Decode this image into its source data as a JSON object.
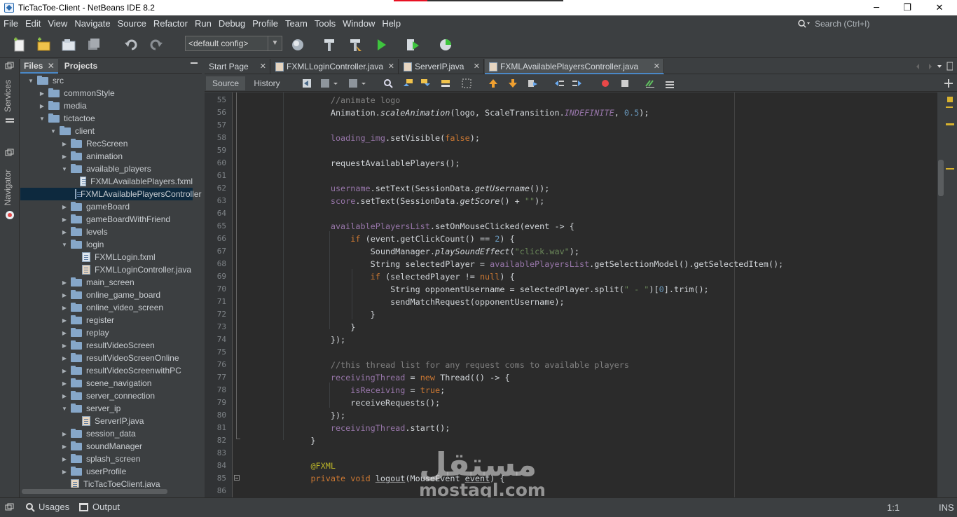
{
  "window": {
    "title": "TicTacToe-Client - NetBeans IDE 8.2",
    "minimize": "─",
    "maximize": "❐",
    "close": "✕"
  },
  "menu": {
    "items": [
      "File",
      "Edit",
      "View",
      "Navigate",
      "Source",
      "Refactor",
      "Run",
      "Debug",
      "Profile",
      "Team",
      "Tools",
      "Window",
      "Help"
    ],
    "search_placeholder": "Search (Ctrl+I)"
  },
  "toolbar": {
    "config_value": "<default config>"
  },
  "panel": {
    "tabs": [
      {
        "label": "Files",
        "close": "✕"
      },
      {
        "label": "Projects"
      }
    ],
    "tree": [
      {
        "indent": 0,
        "expand": "▼",
        "type": "folder",
        "label": "src"
      },
      {
        "indent": 1,
        "expand": "▶",
        "type": "folder",
        "label": "commonStyle"
      },
      {
        "indent": 1,
        "expand": "▶",
        "type": "folder",
        "label": "media"
      },
      {
        "indent": 1,
        "expand": "▼",
        "type": "folder",
        "label": "tictactoe"
      },
      {
        "indent": 2,
        "expand": "▼",
        "type": "folder",
        "label": "client"
      },
      {
        "indent": 3,
        "expand": "▶",
        "type": "folder",
        "label": "RecScreen"
      },
      {
        "indent": 3,
        "expand": "▶",
        "type": "folder",
        "label": "animation"
      },
      {
        "indent": 3,
        "expand": "▼",
        "type": "folder",
        "label": "available_players"
      },
      {
        "indent": 4,
        "expand": "",
        "type": "fxml",
        "label": "FXMLAvailablePlayers.fxml"
      },
      {
        "indent": 4,
        "expand": "",
        "type": "java",
        "label": "FXMLAvailablePlayersController",
        "selected": true
      },
      {
        "indent": 3,
        "expand": "▶",
        "type": "folder",
        "label": "gameBoard"
      },
      {
        "indent": 3,
        "expand": "▶",
        "type": "folder",
        "label": "gameBoardWithFriend"
      },
      {
        "indent": 3,
        "expand": "▶",
        "type": "folder",
        "label": "levels"
      },
      {
        "indent": 3,
        "expand": "▼",
        "type": "folder",
        "label": "login"
      },
      {
        "indent": 4,
        "expand": "",
        "type": "fxml",
        "label": "FXMLLogin.fxml"
      },
      {
        "indent": 4,
        "expand": "",
        "type": "java",
        "label": "FXMLLoginController.java"
      },
      {
        "indent": 3,
        "expand": "▶",
        "type": "folder",
        "label": "main_screen"
      },
      {
        "indent": 3,
        "expand": "▶",
        "type": "folder",
        "label": "online_game_board"
      },
      {
        "indent": 3,
        "expand": "▶",
        "type": "folder",
        "label": "online_video_screen"
      },
      {
        "indent": 3,
        "expand": "▶",
        "type": "folder",
        "label": "register"
      },
      {
        "indent": 3,
        "expand": "▶",
        "type": "folder",
        "label": "replay"
      },
      {
        "indent": 3,
        "expand": "▶",
        "type": "folder",
        "label": "resultVideoScreen"
      },
      {
        "indent": 3,
        "expand": "▶",
        "type": "folder",
        "label": "resultVideoScreenOnline"
      },
      {
        "indent": 3,
        "expand": "▶",
        "type": "folder",
        "label": "resultVideoScreenwithPC"
      },
      {
        "indent": 3,
        "expand": "▶",
        "type": "folder",
        "label": "scene_navigation"
      },
      {
        "indent": 3,
        "expand": "▶",
        "type": "folder",
        "label": "server_connection"
      },
      {
        "indent": 3,
        "expand": "▼",
        "type": "folder",
        "label": "server_ip"
      },
      {
        "indent": 4,
        "expand": "",
        "type": "java",
        "label": "ServerIP.java"
      },
      {
        "indent": 3,
        "expand": "▶",
        "type": "folder",
        "label": "session_data"
      },
      {
        "indent": 3,
        "expand": "▶",
        "type": "folder",
        "label": "soundManager"
      },
      {
        "indent": 3,
        "expand": "▶",
        "type": "folder",
        "label": "splash_screen"
      },
      {
        "indent": 3,
        "expand": "▶",
        "type": "folder",
        "label": "userProfile"
      },
      {
        "indent": 3,
        "expand": "",
        "type": "java",
        "label": "TicTacToeClient.java"
      }
    ]
  },
  "side_labels": {
    "services": "Services",
    "navigator": "Navigator"
  },
  "editor_tabs": [
    {
      "label": "Start Page",
      "close": "✕"
    },
    {
      "label": "FXMLLoginController.java",
      "close": "✕"
    },
    {
      "label": "ServerIP.java",
      "close": "✕"
    },
    {
      "label": "FXMLAvailablePlayersController.java",
      "close": "✕",
      "active": true
    }
  ],
  "editor_toolbar": {
    "source": "Source",
    "history": "History"
  },
  "code": [
    {
      "n": "55",
      "tokens": [
        [
          "                  ",
          ""
        ],
        [
          "//animate logo",
          "c-com"
        ]
      ]
    },
    {
      "n": "56",
      "tokens": [
        [
          "                  Animation.",
          ""
        ],
        [
          "scaleAnimation",
          "c-it"
        ],
        [
          "(logo, ScaleTransition.",
          ""
        ],
        [
          "INDEFINITE",
          "c-fld c-it"
        ],
        [
          ", ",
          ""
        ],
        [
          "0.5",
          "c-num"
        ],
        [
          ");",
          ""
        ]
      ]
    },
    {
      "n": "57",
      "tokens": [
        [
          "",
          ""
        ]
      ]
    },
    {
      "n": "58",
      "tokens": [
        [
          "                  ",
          ""
        ],
        [
          "loading_img",
          "c-fld"
        ],
        [
          ".setVisible(",
          ""
        ],
        [
          "false",
          "c-kw"
        ],
        [
          ");",
          ""
        ]
      ]
    },
    {
      "n": "59",
      "tokens": [
        [
          "",
          ""
        ]
      ]
    },
    {
      "n": "60",
      "tokens": [
        [
          "                  requestAvailablePlayers();",
          ""
        ]
      ]
    },
    {
      "n": "61",
      "tokens": [
        [
          "",
          ""
        ]
      ]
    },
    {
      "n": "62",
      "tokens": [
        [
          "                  ",
          ""
        ],
        [
          "username",
          "c-fld"
        ],
        [
          ".setText(SessionData.",
          ""
        ],
        [
          "getUsername",
          "c-it"
        ],
        [
          "());",
          ""
        ]
      ]
    },
    {
      "n": "63",
      "tokens": [
        [
          "                  ",
          ""
        ],
        [
          "score",
          "c-fld"
        ],
        [
          ".setText(SessionData.",
          ""
        ],
        [
          "getScore",
          "c-it"
        ],
        [
          "() + ",
          ""
        ],
        [
          "\"\"",
          "c-str"
        ],
        [
          ");",
          ""
        ]
      ]
    },
    {
      "n": "64",
      "tokens": [
        [
          "",
          ""
        ]
      ]
    },
    {
      "n": "65",
      "tokens": [
        [
          "                  ",
          ""
        ],
        [
          "availablePlayersList",
          "c-fld"
        ],
        [
          ".setOnMouseClicked(event -> {",
          ""
        ]
      ]
    },
    {
      "n": "66",
      "tokens": [
        [
          "                      ",
          ""
        ],
        [
          "if",
          "c-kw"
        ],
        [
          " (event.getClickCount() == ",
          ""
        ],
        [
          "2",
          "c-num"
        ],
        [
          ") {",
          ""
        ]
      ]
    },
    {
      "n": "67",
      "tokens": [
        [
          "                          SoundManager.",
          ""
        ],
        [
          "playSoundEffect",
          "c-it"
        ],
        [
          "(",
          ""
        ],
        [
          "\"click.wav\"",
          "c-str"
        ],
        [
          ");",
          ""
        ]
      ]
    },
    {
      "n": "68",
      "tokens": [
        [
          "                          String selectedPlayer = ",
          ""
        ],
        [
          "availablePlayersList",
          "c-fld"
        ],
        [
          ".getSelectionModel().getSelectedItem();",
          ""
        ]
      ]
    },
    {
      "n": "69",
      "tokens": [
        [
          "                          ",
          ""
        ],
        [
          "if",
          "c-kw"
        ],
        [
          " (selectedPlayer != ",
          ""
        ],
        [
          "null",
          "c-kw"
        ],
        [
          ") {",
          ""
        ]
      ]
    },
    {
      "n": "70",
      "tokens": [
        [
          "                              String opponentUsername = selectedPlayer.split(",
          ""
        ],
        [
          "\" - \"",
          "c-str"
        ],
        [
          ")[",
          ""
        ],
        [
          "0",
          "c-num"
        ],
        [
          "].trim();",
          ""
        ]
      ]
    },
    {
      "n": "71",
      "tokens": [
        [
          "                              sendMatchRequest(opponentUsername);",
          ""
        ]
      ]
    },
    {
      "n": "72",
      "tokens": [
        [
          "                          }",
          ""
        ]
      ]
    },
    {
      "n": "73",
      "tokens": [
        [
          "                      }",
          ""
        ]
      ]
    },
    {
      "n": "74",
      "tokens": [
        [
          "                  });",
          ""
        ]
      ]
    },
    {
      "n": "75",
      "tokens": [
        [
          "",
          ""
        ]
      ]
    },
    {
      "n": "76",
      "tokens": [
        [
          "                  ",
          ""
        ],
        [
          "//this thread list for any request coms to available players",
          "c-com"
        ]
      ]
    },
    {
      "n": "77",
      "tokens": [
        [
          "                  ",
          ""
        ],
        [
          "receivingThread",
          "c-fld"
        ],
        [
          " = ",
          ""
        ],
        [
          "new",
          "c-kw"
        ],
        [
          " Thread(() -> {",
          ""
        ]
      ]
    },
    {
      "n": "78",
      "tokens": [
        [
          "                      ",
          ""
        ],
        [
          "isReceiving",
          "c-fld"
        ],
        [
          " = ",
          ""
        ],
        [
          "true",
          "c-kw"
        ],
        [
          ";",
          ""
        ]
      ]
    },
    {
      "n": "79",
      "tokens": [
        [
          "                      receiveRequests();",
          ""
        ]
      ]
    },
    {
      "n": "80",
      "tokens": [
        [
          "                  });",
          ""
        ]
      ]
    },
    {
      "n": "81",
      "tokens": [
        [
          "                  ",
          ""
        ],
        [
          "receivingThread",
          "c-fld"
        ],
        [
          ".start();",
          ""
        ]
      ]
    },
    {
      "n": "82",
      "tokens": [
        [
          "              }",
          ""
        ]
      ]
    },
    {
      "n": "83",
      "tokens": [
        [
          "",
          ""
        ]
      ]
    },
    {
      "n": "84",
      "tokens": [
        [
          "              ",
          ""
        ],
        [
          "@FXML",
          "c-ann"
        ]
      ]
    },
    {
      "n": "85",
      "tokens": [
        [
          "              ",
          ""
        ],
        [
          "private",
          "c-kw"
        ],
        [
          " ",
          ""
        ],
        [
          "void",
          "c-kw"
        ],
        [
          " ",
          ""
        ],
        [
          "logout",
          "c-ul"
        ],
        [
          "(MouseEvent ",
          ""
        ],
        [
          "event",
          "c-ul"
        ],
        [
          ") {",
          ""
        ]
      ]
    },
    {
      "n": "86",
      "tokens": [
        [
          "",
          ""
        ]
      ]
    }
  ],
  "status": {
    "usages": "Usages",
    "output": "Output",
    "position": "1:1",
    "mode": "INS"
  },
  "watermark": {
    "arabic": "مستقل",
    "latin": "mostaql.com"
  },
  "colors": {
    "accent": "#4a88c7",
    "selection": "#0d293e",
    "keyword": "#cc7832",
    "string": "#6a8759",
    "field": "#9876aa",
    "comment": "#808080",
    "number": "#6897bb"
  }
}
